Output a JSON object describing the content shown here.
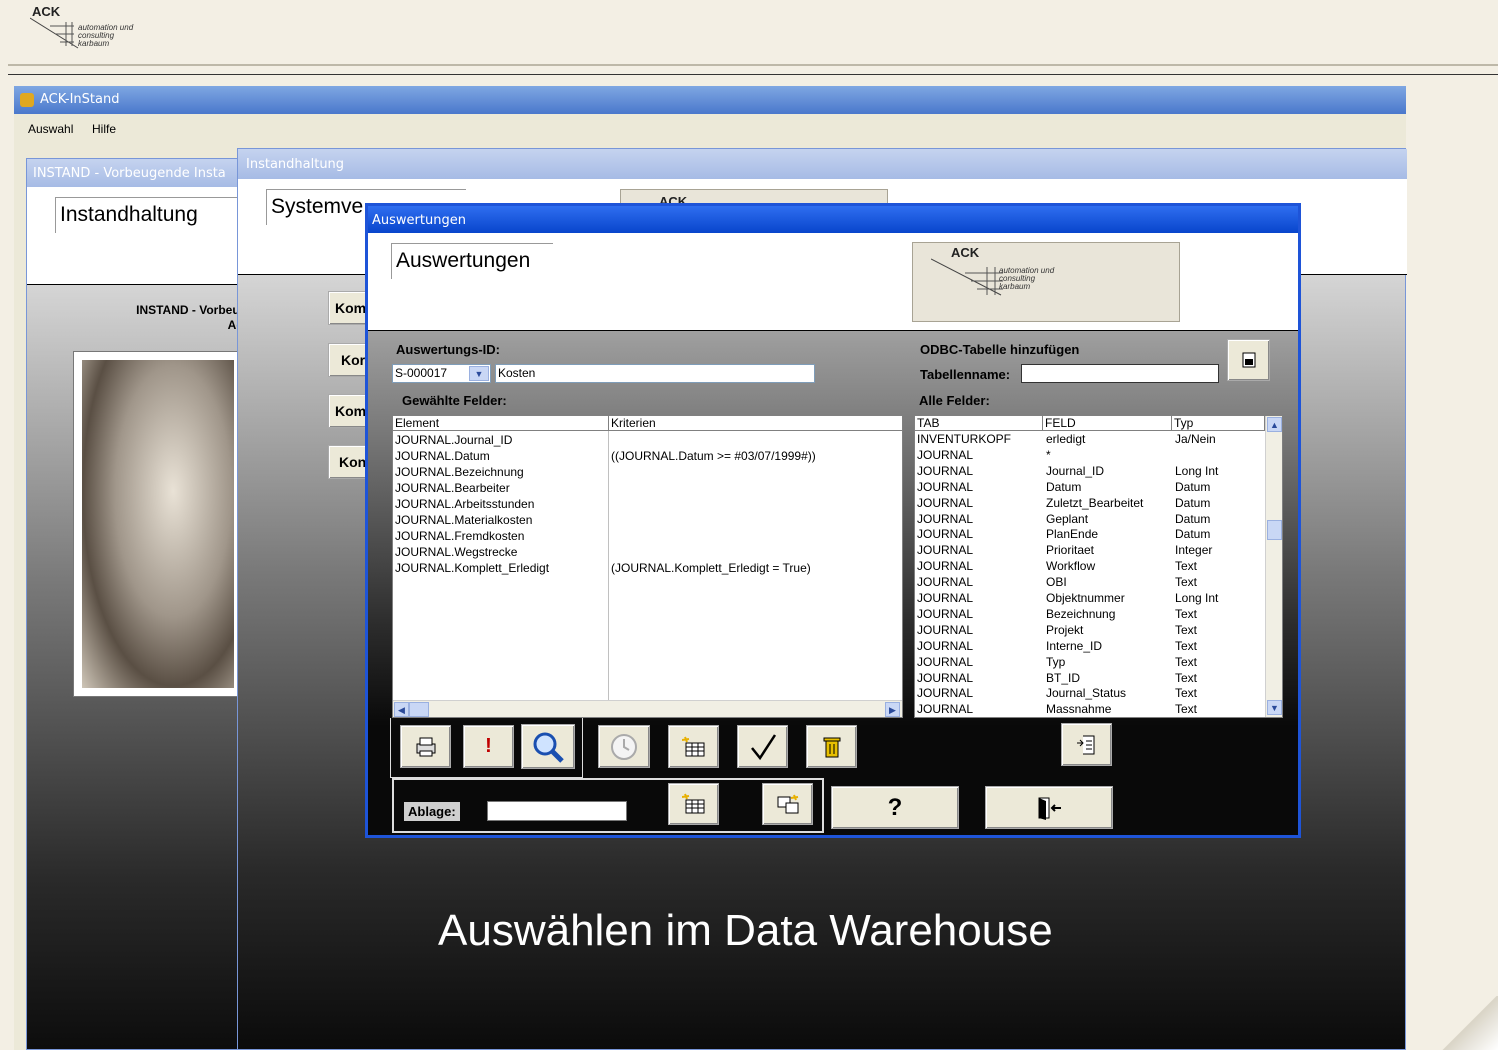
{
  "top_logo": {
    "brand": "ACK",
    "tagline": [
      "automation und",
      "consulting",
      "karbaum"
    ]
  },
  "app": {
    "title": "ACK-InStand",
    "menu": [
      "Auswahl",
      "Hilfe"
    ]
  },
  "win_instand": {
    "title": "INSTAND - Vorbeugende Insta",
    "heading": "Instandhaltung",
    "subtitle_line1": "INSTAND - Vorbeug",
    "subtitle_line2": "Agi"
  },
  "win_instandhaltung": {
    "title": "Instandhaltung",
    "heading": "Systemve",
    "buttons": [
      "Kom",
      "Kor",
      "Kom",
      "Kon"
    ],
    "logo_brand": "ACK"
  },
  "dialog": {
    "title": "Auswertungen",
    "heading": "Auswertungen",
    "logo": {
      "brand": "ACK",
      "tagline": [
        "automation und",
        "consulting",
        "karbaum"
      ]
    },
    "auswertungs_id_label": "Auswertungs-ID:",
    "auswertungs_id_value": "S-000017",
    "auswertungs_name": "Kosten",
    "gewaehlte_felder_label": "Gewählte Felder:",
    "odbc_label": "ODBC-Tabelle hinzufügen",
    "tabellenname_label": "Tabellenname:",
    "tabellenname_value": "",
    "alle_felder_label": "Alle Felder:",
    "selected_headers": [
      "Element",
      "Kriterien"
    ],
    "selected_rows": [
      [
        "JOURNAL.Journal_ID",
        ""
      ],
      [
        "JOURNAL.Datum",
        "((JOURNAL.Datum >= #03/07/1999#))"
      ],
      [
        "JOURNAL.Bezeichnung",
        ""
      ],
      [
        "JOURNAL.Bearbeiter",
        ""
      ],
      [
        "JOURNAL.Arbeitsstunden",
        ""
      ],
      [
        "JOURNAL.Materialkosten",
        ""
      ],
      [
        "JOURNAL.Fremdkosten",
        ""
      ],
      [
        "JOURNAL.Wegstrecke",
        ""
      ],
      [
        "JOURNAL.Komplett_Erledigt",
        "(JOURNAL.Komplett_Erledigt = True)"
      ]
    ],
    "fields_headers": [
      "TAB",
      "FELD",
      "Typ"
    ],
    "fields_rows": [
      [
        "INVENTURKOPF",
        "erledigt",
        "Ja/Nein"
      ],
      [
        "JOURNAL",
        "*",
        ""
      ],
      [
        "JOURNAL",
        "Journal_ID",
        "Long Int"
      ],
      [
        "JOURNAL",
        "Datum",
        "Datum"
      ],
      [
        "JOURNAL",
        "Zuletzt_Bearbeitet",
        "Datum"
      ],
      [
        "JOURNAL",
        "Geplant",
        "Datum"
      ],
      [
        "JOURNAL",
        "PlanEnde",
        "Datum"
      ],
      [
        "JOURNAL",
        "Prioritaet",
        "Integer"
      ],
      [
        "JOURNAL",
        "Workflow",
        "Text"
      ],
      [
        "JOURNAL",
        "OBI",
        "Text"
      ],
      [
        "JOURNAL",
        "Objektnummer",
        "Long Int"
      ],
      [
        "JOURNAL",
        "Bezeichnung",
        "Text"
      ],
      [
        "JOURNAL",
        "Projekt",
        "Text"
      ],
      [
        "JOURNAL",
        "Interne_ID",
        "Text"
      ],
      [
        "JOURNAL",
        "Typ",
        "Text"
      ],
      [
        "JOURNAL",
        "BT_ID",
        "Text"
      ],
      [
        "JOURNAL",
        "Journal_Status",
        "Text"
      ],
      [
        "JOURNAL",
        "Massnahme",
        "Text"
      ]
    ],
    "ablage_label": "Ablage:",
    "ablage_value": ""
  },
  "caption": "Auswählen im Data Warehouse"
}
